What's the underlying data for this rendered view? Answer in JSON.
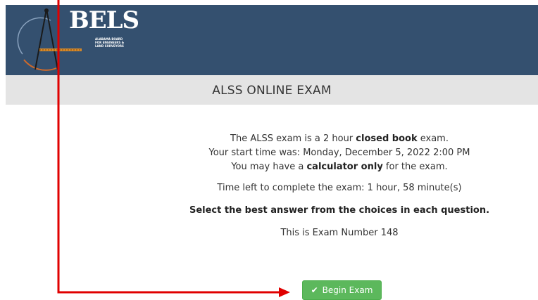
{
  "header": {
    "logo_text": "BELS",
    "logo_subtitle_line1": "ALABAMA BOARD",
    "logo_subtitle_line2": "FOR ENGINEERS &",
    "logo_subtitle_line3": "LAND SURVEYORS",
    "background": "#34506f"
  },
  "banner": {
    "title": "ALSS ONLINE EXAM"
  },
  "exam": {
    "line1_pre": "The ALSS exam is a 2 hour ",
    "line1_bold": "closed book",
    "line1_post": " exam.",
    "start_time": "Your start time was: Monday, December 5, 2022 2:00 PM",
    "line3_pre": "You may have a ",
    "line3_bold": "calculator only",
    "line3_post": " for the exam.",
    "time_left": "Time left to complete the exam: 1 hour, 58 minute(s)",
    "instructions": "Select the best answer from the choices in each question.",
    "exam_number": "This is Exam Number 148"
  },
  "actions": {
    "begin_label": "Begin Exam",
    "begin_color": "#5cb85c",
    "check_icon": "✔"
  },
  "annotation": {
    "arrow_color": "#e00000"
  }
}
